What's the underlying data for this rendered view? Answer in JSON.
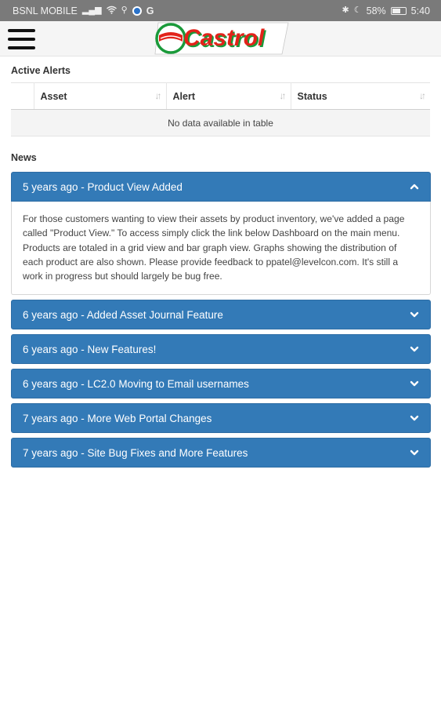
{
  "status_bar": {
    "carrier": "BSNL MOBILE",
    "battery": "58%",
    "time": "5:40",
    "g_label": "G"
  },
  "header": {
    "brand": "Castrol",
    "colors": {
      "green": "#1a9a3a",
      "red": "#e2231a",
      "nav_blue": "#337ab7"
    }
  },
  "alerts": {
    "title": "Active Alerts",
    "columns": [
      "Asset",
      "Alert",
      "Status"
    ],
    "empty_message": "No data available in table"
  },
  "news": {
    "title": "News",
    "items": [
      {
        "heading": "5 years ago - Product View Added",
        "expanded": true,
        "body": "For those customers wanting to view their assets by product inventory, we've added a page called \"Product View.\" To access simply click the link below Dashboard on the main menu. Products are totaled in a grid view and bar graph view. Graphs showing the distribution of each product are also shown. Please provide feedback to ppatel@levelcon.com. It's still a work in progress but should largely be bug free."
      },
      {
        "heading": "6 years ago - Added Asset Journal Feature",
        "expanded": false
      },
      {
        "heading": "6 years ago - New Features!",
        "expanded": false
      },
      {
        "heading": "6 years ago - LC2.0 Moving to Email usernames",
        "expanded": false
      },
      {
        "heading": "7 years ago - More Web Portal Changes",
        "expanded": false
      },
      {
        "heading": "7 years ago - Site Bug Fixes and More Features",
        "expanded": false
      }
    ]
  }
}
